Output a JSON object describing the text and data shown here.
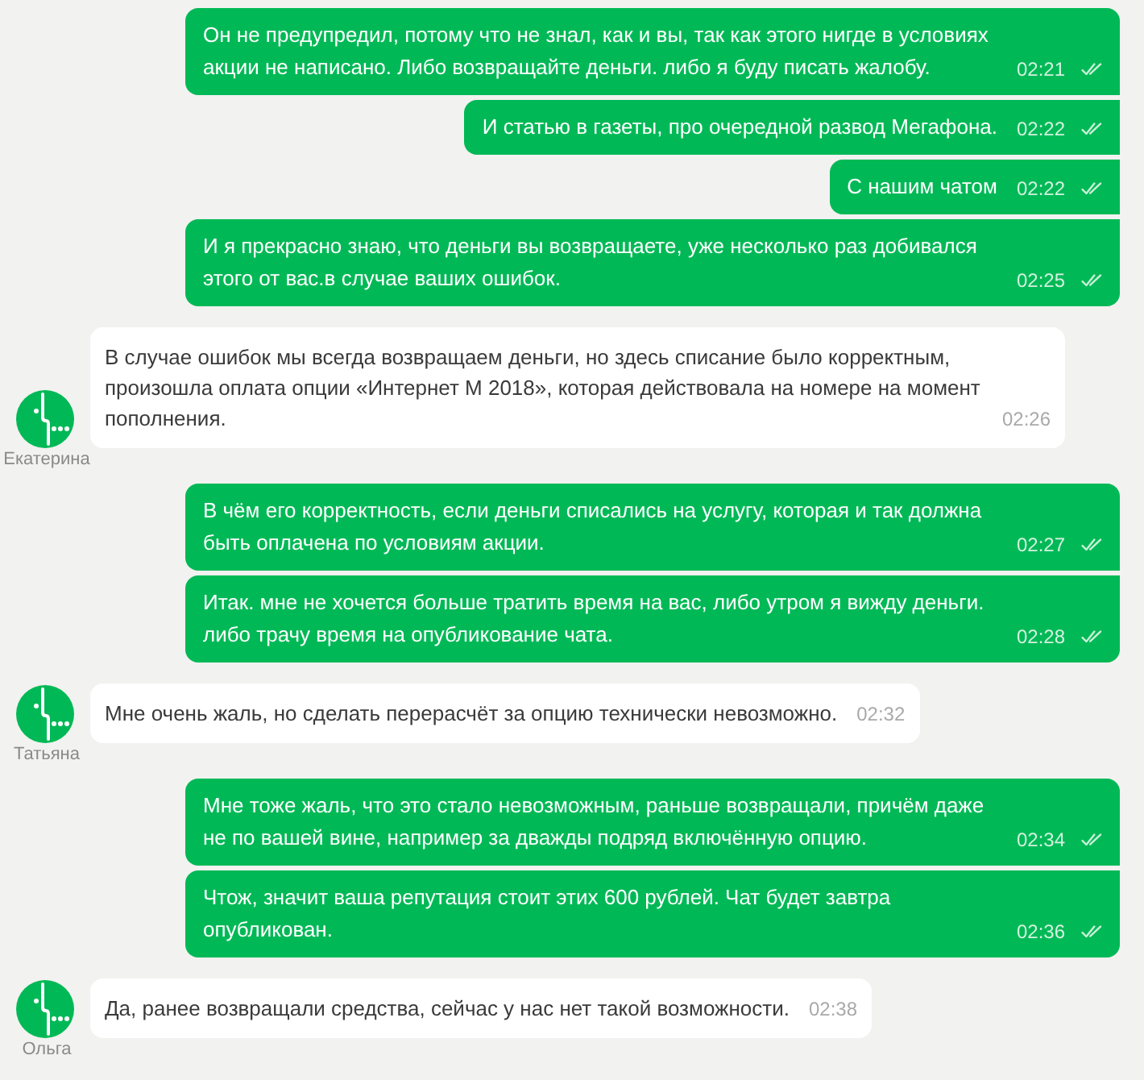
{
  "messages": [
    {
      "kind": "outgoing",
      "text": "Он не предупредил, потому что не знал, как и вы, так как этого нигде в условиях акции не написано. Либо возвращайте деньги. либо я буду писать жалобу.",
      "time": "02:21",
      "read": true
    },
    {
      "kind": "outgoing",
      "text": "И статью в газеты, про очередной развод Мегафона.",
      "time": "02:22",
      "read": true
    },
    {
      "kind": "outgoing",
      "text": "С нашим чатом",
      "time": "02:22",
      "read": true
    },
    {
      "kind": "outgoing",
      "text": "И я прекрасно знаю, что деньги вы возвращаете, уже несколько раз добивался этого от вас.в случае ваших ошибок.",
      "time": "02:25",
      "read": true
    },
    {
      "kind": "incoming",
      "author": "Екатерина",
      "text": "В случае ошибок мы всегда возвращаем деньги, но здесь списание было корректным, произошла оплата опции «Интернет М 2018», которая действовала на номере на момент пополнения.",
      "time": "02:26"
    },
    {
      "kind": "outgoing",
      "text": "В чём его корректность, если деньги списались на услугу, которая и так должна быть оплачена по условиям акции.",
      "time": "02:27",
      "read": true
    },
    {
      "kind": "outgoing",
      "text": "Итак. мне не хочется больше тратить время на вас, либо утром я вижду деньги. либо трачу время на опубликование чата.",
      "time": "02:28",
      "read": true
    },
    {
      "kind": "incoming",
      "author": "Татьяна",
      "text": "Мне очень жаль, но сделать перерасчёт за опцию технически невозможно.",
      "time": "02:32"
    },
    {
      "kind": "outgoing",
      "text": "Мне тоже жаль, что это стало невозможным, раньше возвращали, причём даже не по вашей вине, например за дважды подряд включённую опцию.",
      "time": "02:34",
      "read": true
    },
    {
      "kind": "outgoing",
      "text": "Чтож, значит ваша репутация стоит этих 600 рублей. Чат будет завтра опубликован.",
      "time": "02:36",
      "read": true
    },
    {
      "kind": "incoming",
      "author": "Ольга",
      "text": "Да, ранее возвращали средства, сейчас у нас нет такой возможности.",
      "time": "02:38"
    }
  ]
}
